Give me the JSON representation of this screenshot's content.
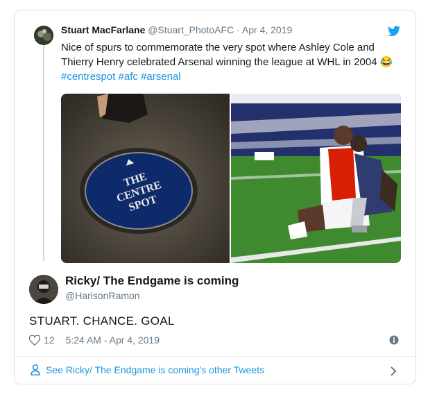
{
  "quoted": {
    "name": "Stuart MacFarlane",
    "handle": "@Stuart_PhotoAFC",
    "separator": "·",
    "date": "Apr 4, 2019",
    "text": "Nice of spurs to commemorate the very spot where Ashley Cole and Thierry Henry celebrated Arsenal winning the league at WHL in 2004",
    "emoji": "😂",
    "hashtags": "#centrespot #afc #arsenal",
    "photos": [
      {
        "sign_line1": "THE",
        "sign_line2": "CENTRE",
        "sign_line3": "SPOT"
      },
      {
        "description_icon": "celebration-photo"
      }
    ]
  },
  "author": {
    "name": "Ricky/ The Endgame is coming",
    "handle": "@HarisonRamon"
  },
  "tweet": {
    "text": "STUART. CHANCE. GOAL",
    "likes": "12",
    "timestamp": "5:24 AM - Apr 4, 2019"
  },
  "footer": {
    "link": "See Ricky/ The Endgame is coming's other Tweets"
  },
  "colors": {
    "link": "#1b95e0",
    "muted": "#657786",
    "border": "#d9dde1"
  }
}
